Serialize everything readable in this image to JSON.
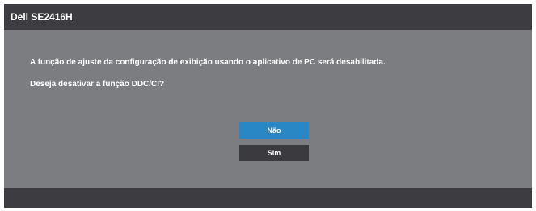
{
  "header": {
    "title": "Dell SE2416H"
  },
  "dialog": {
    "message_1": "A função de ajuste da configuração de exibição usando o aplicativo de PC será desabilitada.",
    "message_2": "Deseja desativar a função DDC/CI?"
  },
  "buttons": {
    "no_label": "Não",
    "yes_label": "Sim",
    "selected": "Não"
  },
  "colors": {
    "panel_background": "#7c7d81",
    "header_background": "#3d3d41",
    "selected_button": "#2a87c6",
    "unselected_button": "#3b3b3f",
    "text": "#ffffff"
  }
}
